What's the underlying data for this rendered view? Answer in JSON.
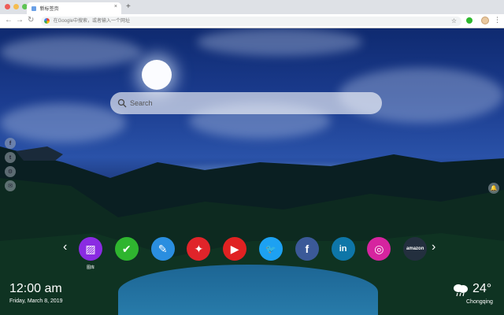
{
  "browser": {
    "tab_title": "新标签页",
    "tab_close": "×",
    "new_tab": "+",
    "back": "←",
    "forward": "→",
    "reload": "↻",
    "omnibox_placeholder": "在Google中搜索，或者输入一个网址",
    "star": "☆",
    "menu": "⋮",
    "traffic_lights": [
      "#ee5d58",
      "#f5bd4f",
      "#5fc454"
    ]
  },
  "search": {
    "placeholder": "Search"
  },
  "sidebar": {
    "social": [
      {
        "name": "facebook",
        "glyph": "f"
      },
      {
        "name": "twitter",
        "glyph": "t"
      },
      {
        "name": "settings",
        "glyph": "⚙"
      },
      {
        "name": "chat",
        "glyph": "✉"
      }
    ],
    "bell": "🔔"
  },
  "dock": {
    "prev": "‹",
    "next": "›",
    "apps": [
      {
        "name": "gallery",
        "label": "图库",
        "color": "#8a2be2",
        "glyph": "▨"
      },
      {
        "name": "tasks",
        "label": "",
        "color": "#2fb52f",
        "glyph": "✔"
      },
      {
        "name": "notes",
        "label": "",
        "color": "#2a8ee0",
        "glyph": "✎"
      },
      {
        "name": "games",
        "label": "",
        "color": "#e0242a",
        "glyph": "✦"
      },
      {
        "name": "youtube",
        "label": "",
        "color": "#e02222",
        "glyph": "▶"
      },
      {
        "name": "twitter",
        "label": "",
        "color": "#1da1f2",
        "glyph": "🐦"
      },
      {
        "name": "facebook",
        "label": "",
        "color": "#3b5998",
        "glyph": "f"
      },
      {
        "name": "linkedin",
        "label": "",
        "color": "#0e76a8",
        "glyph": "in"
      },
      {
        "name": "instagram",
        "label": "",
        "color": "#d6249f",
        "glyph": "◎"
      },
      {
        "name": "amazon",
        "label": "",
        "color": "#232f3e",
        "glyph": "amazon"
      }
    ]
  },
  "clock": {
    "time": "12:00 am",
    "date": "Friday, March 8, 2019"
  },
  "weather": {
    "temperature": "24°",
    "city": "Chongqing",
    "icon": "cloud-rain-icon"
  }
}
